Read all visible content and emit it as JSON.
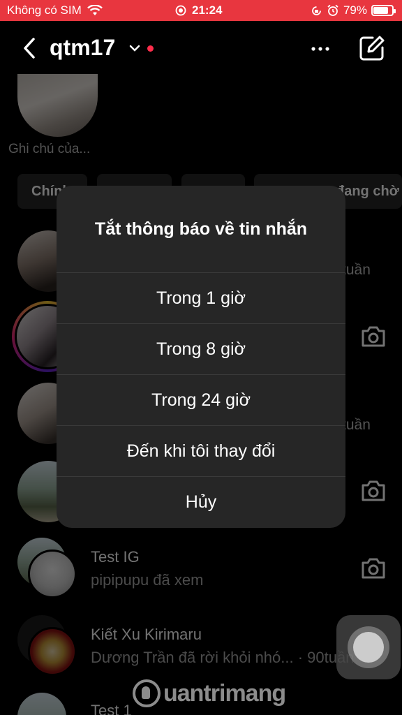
{
  "status_bar": {
    "carrier": "Không có SIM",
    "time": "21:24",
    "battery": "79%",
    "battery_level": 0.79,
    "icons": [
      "wifi-icon",
      "screen-record-icon",
      "rotation-lock-icon",
      "alarm-icon",
      "battery-icon"
    ]
  },
  "header": {
    "account_name": "qtm17",
    "icons": [
      "back-icon",
      "chevron-down-icon",
      "more-icon",
      "compose-icon"
    ]
  },
  "note": {
    "label": "Ghi chú của..."
  },
  "tabs": [
    {
      "label": "Chính"
    },
    {
      "label": ""
    },
    {
      "label": ""
    },
    {
      "label": "đang chờ"
    }
  ],
  "threads": [
    {
      "name": "",
      "subtitle": "",
      "time": "tuần"
    },
    {
      "name": "",
      "subtitle": "",
      "time": ""
    },
    {
      "name": "",
      "subtitle": "",
      "time": "tuần"
    },
    {
      "name": "",
      "subtitle": "",
      "time": ""
    },
    {
      "name": "Test IG",
      "subtitle": "pipipupu đã xem",
      "time": ""
    },
    {
      "name": "Kiết Xu Kirimaru",
      "subtitle": "Dương Trần đã rời khỏi nhó... · 90tuần",
      "time": ""
    },
    {
      "name": "Test 1",
      "subtitle": "",
      "time": ""
    }
  ],
  "action_sheet": {
    "title": "Tắt thông báo về tin nhắn",
    "options": [
      "Trong 1 giờ",
      "Trong 8 giờ",
      "Trong 24 giờ",
      "Đến khi tôi thay đổi",
      "Hủy"
    ]
  },
  "watermark": {
    "text": "uantrimang"
  },
  "colors": {
    "status_bar": "#e8363f",
    "background": "#000000",
    "sheet": "#262626",
    "unread_dot": "#ff2d4b"
  }
}
